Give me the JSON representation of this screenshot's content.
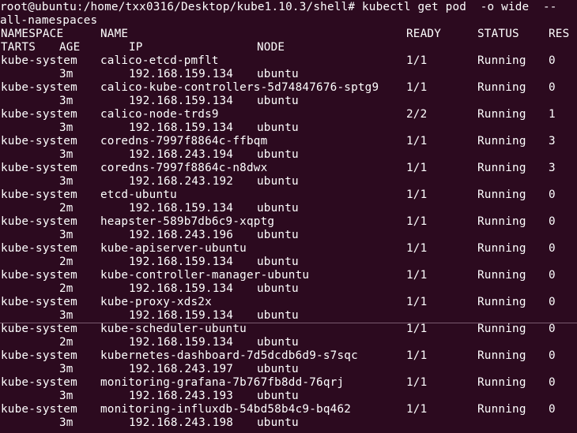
{
  "terminal": {
    "prompt_line1": "root@ubuntu:/home/txx0316/Desktop/kube1.10.3/shell# kubectl get pod  -o wide  --",
    "prompt_line2": "all-namespaces",
    "header": {
      "namespace": "NAMESPACE",
      "name": "NAME",
      "ready": "READY",
      "status": "STATUS",
      "restarts_part1": "RES",
      "restarts_part2": "TARTS",
      "age": "AGE",
      "ip": "IP",
      "node": "NODE"
    },
    "pods": [
      {
        "namespace": "kube-system",
        "name": "calico-etcd-pmflt",
        "ready": "1/1",
        "status": "Running",
        "restarts": "0",
        "age": "3m",
        "ip": "192.168.159.134",
        "node": "ubuntu"
      },
      {
        "namespace": "kube-system",
        "name": "calico-kube-controllers-5d74847676-sptg9",
        "ready": "1/1",
        "status": "Running",
        "restarts": "0",
        "age": "3m",
        "ip": "192.168.159.134",
        "node": "ubuntu"
      },
      {
        "namespace": "kube-system",
        "name": "calico-node-trds9",
        "ready": "2/2",
        "status": "Running",
        "restarts": "1",
        "age": "3m",
        "ip": "192.168.159.134",
        "node": "ubuntu"
      },
      {
        "namespace": "kube-system",
        "name": "coredns-7997f8864c-ffbqm",
        "ready": "1/1",
        "status": "Running",
        "restarts": "3",
        "age": "3m",
        "ip": "192.168.243.194",
        "node": "ubuntu"
      },
      {
        "namespace": "kube-system",
        "name": "coredns-7997f8864c-n8dwx",
        "ready": "1/1",
        "status": "Running",
        "restarts": "3",
        "age": "3m",
        "ip": "192.168.243.192",
        "node": "ubuntu"
      },
      {
        "namespace": "kube-system",
        "name": "etcd-ubuntu",
        "ready": "1/1",
        "status": "Running",
        "restarts": "0",
        "age": "2m",
        "ip": "192.168.159.134",
        "node": "ubuntu"
      },
      {
        "namespace": "kube-system",
        "name": "heapster-589b7db6c9-xqptg",
        "ready": "1/1",
        "status": "Running",
        "restarts": "0",
        "age": "3m",
        "ip": "192.168.243.196",
        "node": "ubuntu"
      },
      {
        "namespace": "kube-system",
        "name": "kube-apiserver-ubuntu",
        "ready": "1/1",
        "status": "Running",
        "restarts": "0",
        "age": "2m",
        "ip": "192.168.159.134",
        "node": "ubuntu"
      },
      {
        "namespace": "kube-system",
        "name": "kube-controller-manager-ubuntu",
        "ready": "1/1",
        "status": "Running",
        "restarts": "0",
        "age": "2m",
        "ip": "192.168.159.134",
        "node": "ubuntu"
      },
      {
        "namespace": "kube-system",
        "name": "kube-proxy-xds2x",
        "ready": "1/1",
        "status": "Running",
        "restarts": "0",
        "age": "3m",
        "ip": "192.168.159.134",
        "node": "ubuntu"
      },
      {
        "namespace": "kube-system",
        "name": "kube-scheduler-ubuntu",
        "ready": "1/1",
        "status": "Running",
        "restarts": "0",
        "age": "2m",
        "ip": "192.168.159.134",
        "node": "ubuntu"
      },
      {
        "namespace": "kube-system",
        "name": "kubernetes-dashboard-7d5dcdb6d9-s7sqc",
        "ready": "1/1",
        "status": "Running",
        "restarts": "0",
        "age": "3m",
        "ip": "192.168.243.197",
        "node": "ubuntu"
      },
      {
        "namespace": "kube-system",
        "name": "monitoring-grafana-7b767fb8dd-76qrj",
        "ready": "1/1",
        "status": "Running",
        "restarts": "0",
        "age": "3m",
        "ip": "192.168.243.193",
        "node": "ubuntu"
      },
      {
        "namespace": "kube-system",
        "name": "monitoring-influxdb-54bd58b4c9-bq462",
        "ready": "1/1",
        "status": "Running",
        "restarts": "0",
        "age": "3m",
        "ip": "192.168.243.198",
        "node": "ubuntu"
      }
    ]
  },
  "colors": {
    "background": "#2c0a1f",
    "foreground": "#ffffff"
  }
}
